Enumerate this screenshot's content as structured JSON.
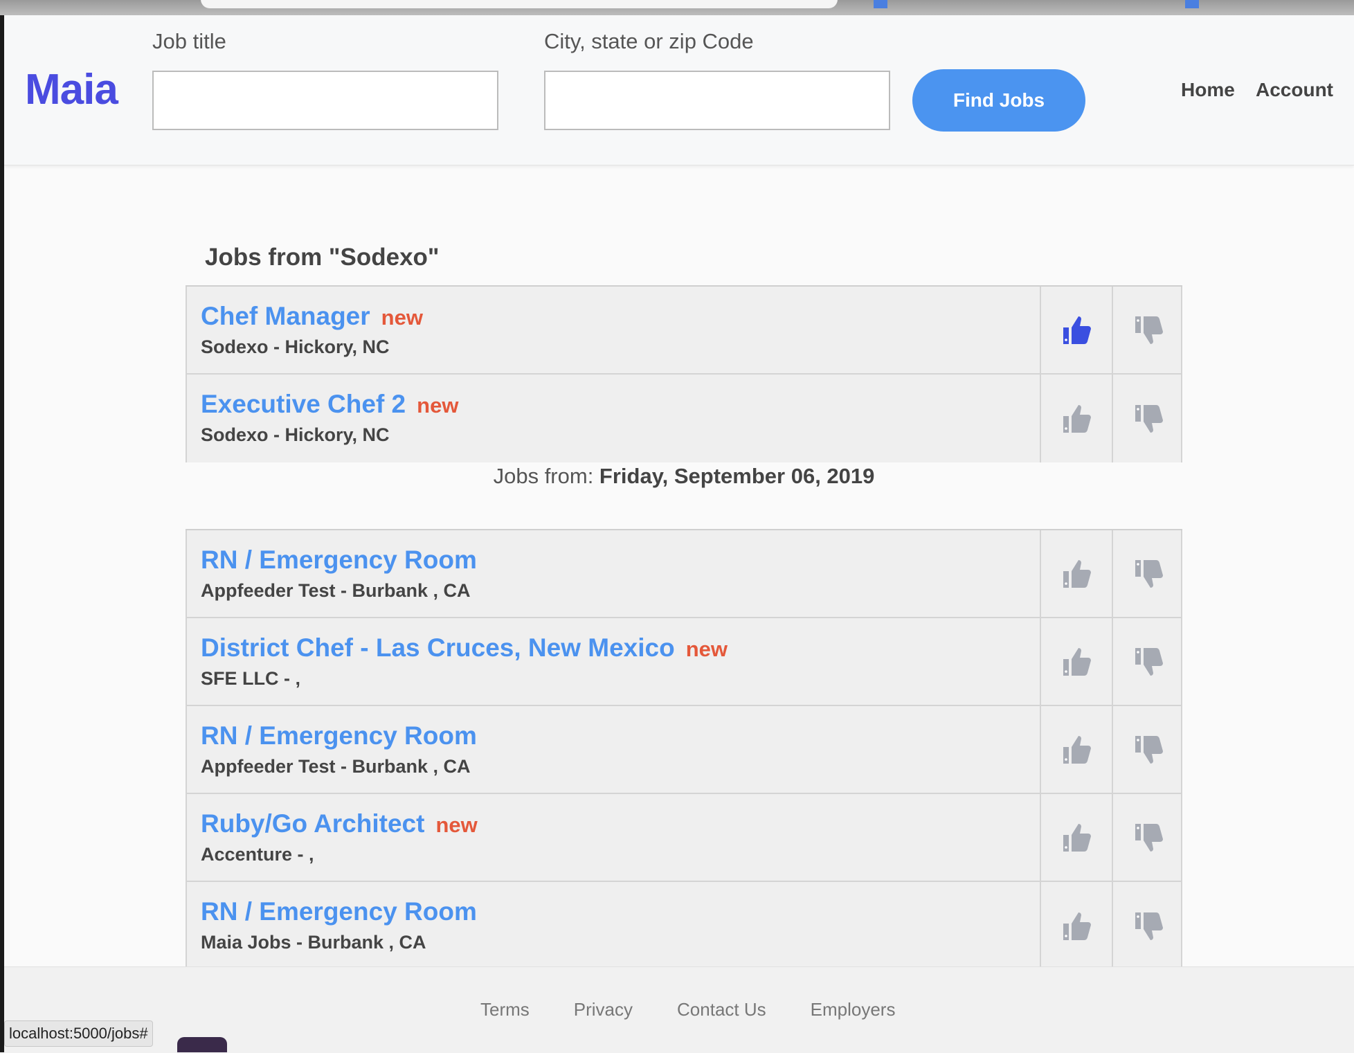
{
  "header": {
    "logo": "Maia",
    "job_title_label": "Job title",
    "job_title_value": "",
    "location_label": "City, state or zip Code",
    "location_value": "",
    "find_button": "Find Jobs",
    "nav": [
      "Home",
      "Account"
    ]
  },
  "company_section": {
    "title": "Jobs from \"Sodexo\"",
    "jobs": [
      {
        "title": "Chef Manager",
        "badge": "new",
        "company": "Sodexo - Hickory, NC",
        "liked": true
      },
      {
        "title": "Executive Chef 2",
        "badge": "new",
        "company": "Sodexo - Hickory, NC",
        "liked": false
      }
    ]
  },
  "date_section": {
    "prefix": "Jobs from: ",
    "date": "Friday, September 06, 2019",
    "jobs": [
      {
        "title": "RN / Emergency Room",
        "badge": "",
        "company": "Appfeeder Test - Burbank , CA",
        "liked": false
      },
      {
        "title": "District Chef - Las Cruces, New Mexico",
        "badge": "new",
        "company": "SFE LLC - ,",
        "liked": false
      },
      {
        "title": "RN / Emergency Room",
        "badge": "",
        "company": "Appfeeder Test - Burbank , CA",
        "liked": false
      },
      {
        "title": "Ruby/Go Architect",
        "badge": "new",
        "company": "Accenture - ,",
        "liked": false
      },
      {
        "title": "RN / Emergency Room",
        "badge": "",
        "company": "Maia Jobs - Burbank , CA",
        "liked": false
      }
    ]
  },
  "footer": {
    "links": [
      "Terms",
      "Privacy",
      "Contact Us",
      "Employers"
    ]
  },
  "status_bar": {
    "url": "localhost:5000/jobs#"
  },
  "icons": {
    "thumbs_up": "thumbs-up-icon",
    "thumbs_down": "thumbs-down-icon"
  },
  "colors": {
    "brand": "#4a4ce0",
    "link": "#4b92ef",
    "new_badge": "#e4583a",
    "button": "#4b94f0",
    "liked": "#3a4fe0",
    "icon_inactive": "#a6aab3"
  }
}
